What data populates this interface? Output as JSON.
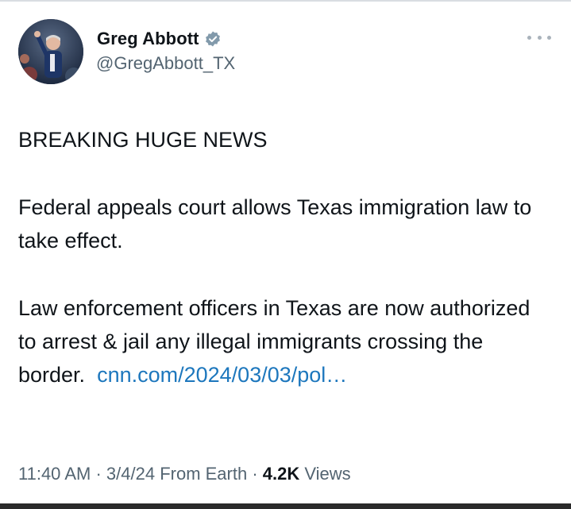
{
  "author": {
    "display_name": "Greg Abbott",
    "handle": "@GregAbbott_TX",
    "verified": true,
    "avatar_icon": "profile-photo"
  },
  "more_icon": "more-dots-icon",
  "tweet": {
    "line1": "BREAKING HUGE NEWS",
    "para2": "Federal appeals court allows Texas immigration law to take effect.",
    "para3_text": "Law enforcement officers in Texas are now authorized to arrest & jail any illegal immigrants crossing the border.",
    "link_text": "cnn.com/2024/03/03/pol…"
  },
  "meta": {
    "time": "11:40 AM",
    "sep1": " · ",
    "date": "3/4/24",
    "source": "From Earth",
    "sep2": " · ",
    "views_count": "4.2K",
    "views_label": "Views"
  },
  "colors": {
    "link": "#1d77bd",
    "text": "#0f1419",
    "secondary": "#536471",
    "verified_badge": "#829aab"
  }
}
